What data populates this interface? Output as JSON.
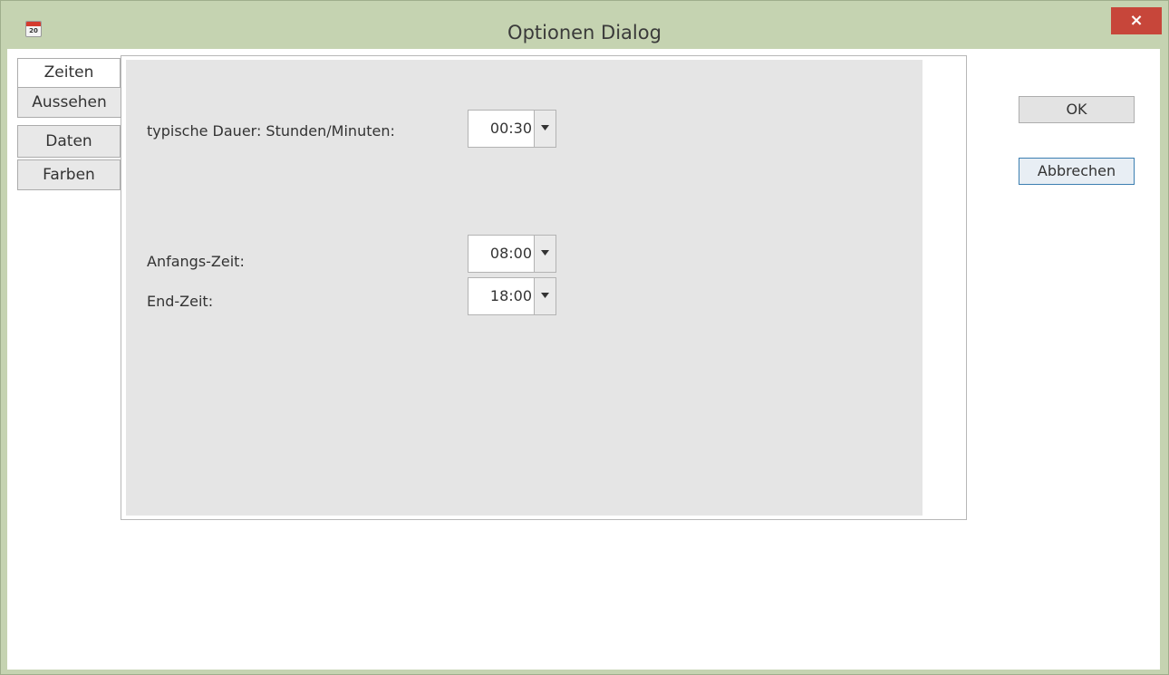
{
  "window": {
    "title": "Optionen Dialog",
    "icon_text": "20",
    "close_glyph": "×"
  },
  "tabs": [
    {
      "label": "Zeiten",
      "active": true
    },
    {
      "label": "Aussehen",
      "active": false
    },
    {
      "label": "Daten",
      "active": false
    },
    {
      "label": "Farben",
      "active": false
    }
  ],
  "fields": {
    "duration": {
      "label": "typische Dauer: Stunden/Minuten:",
      "value": "00:30"
    },
    "start": {
      "label": "Anfangs-Zeit:",
      "value": "08:00"
    },
    "end": {
      "label": "End-Zeit:",
      "value": "18:00"
    }
  },
  "buttons": {
    "ok": "OK",
    "cancel": "Abbrechen"
  },
  "colors": {
    "frame": "#c5d3b1",
    "close": "#c7463a",
    "panel": "#e5e5e5"
  }
}
